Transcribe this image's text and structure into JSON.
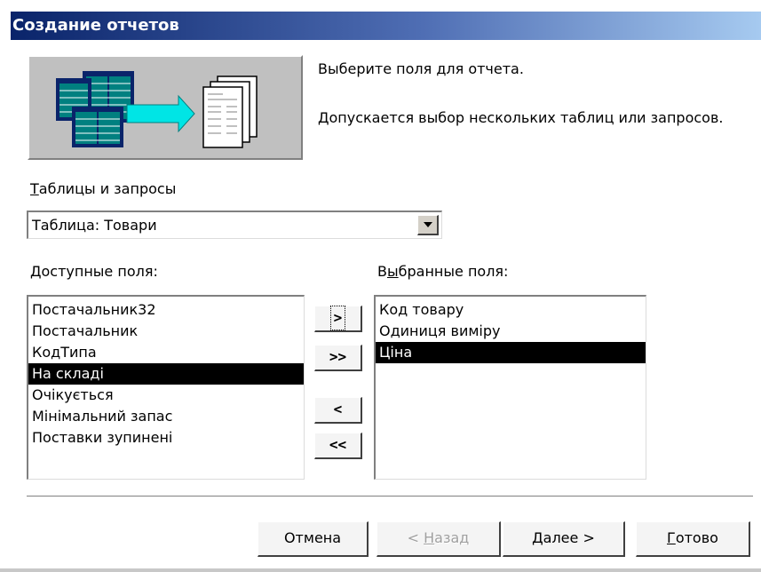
{
  "window": {
    "title": "Создание отчетов"
  },
  "intro": {
    "line1": "Выберите поля для отчета.",
    "line2": "Допускается выбор нескольких таблиц или запросов."
  },
  "source": {
    "label_accel": "Т",
    "label_rest": "аблицы и запросы",
    "selected": "Таблица: Товари"
  },
  "available": {
    "label_pre": "",
    "label_accel": "Д",
    "label_post": "оступные поля:",
    "items": [
      {
        "text": "Постачальник32",
        "selected": false
      },
      {
        "text": "Постачальник",
        "selected": false
      },
      {
        "text": "КодТипа",
        "selected": false
      },
      {
        "text": "На складі",
        "selected": true
      },
      {
        "text": "Очікується",
        "selected": false
      },
      {
        "text": "Мінімальний запас",
        "selected": false
      },
      {
        "text": "Поставки зупинені",
        "selected": false
      }
    ]
  },
  "chosen": {
    "label_pre": "В",
    "label_accel": "ы",
    "label_post": "бранные поля:",
    "items": [
      {
        "text": "Код товару",
        "selected": false
      },
      {
        "text": "Одиниця виміру",
        "selected": false
      },
      {
        "text": "Ціна",
        "selected": true
      }
    ]
  },
  "move_buttons": {
    "add_one": ">",
    "add_all": ">>",
    "remove_one": "<",
    "remove_all": "<<"
  },
  "footer": {
    "cancel": "Отмена",
    "back_pre": "< ",
    "back_accel": "Н",
    "back_post": "азад",
    "next_accel": "Д",
    "next_post": "алее >",
    "finish_accel": "Г",
    "finish_post": "отово"
  },
  "colors": {
    "title_start": "#0a246a",
    "title_end": "#a6caf0",
    "arrow": "#00e5e5",
    "table_teal": "#008080"
  }
}
